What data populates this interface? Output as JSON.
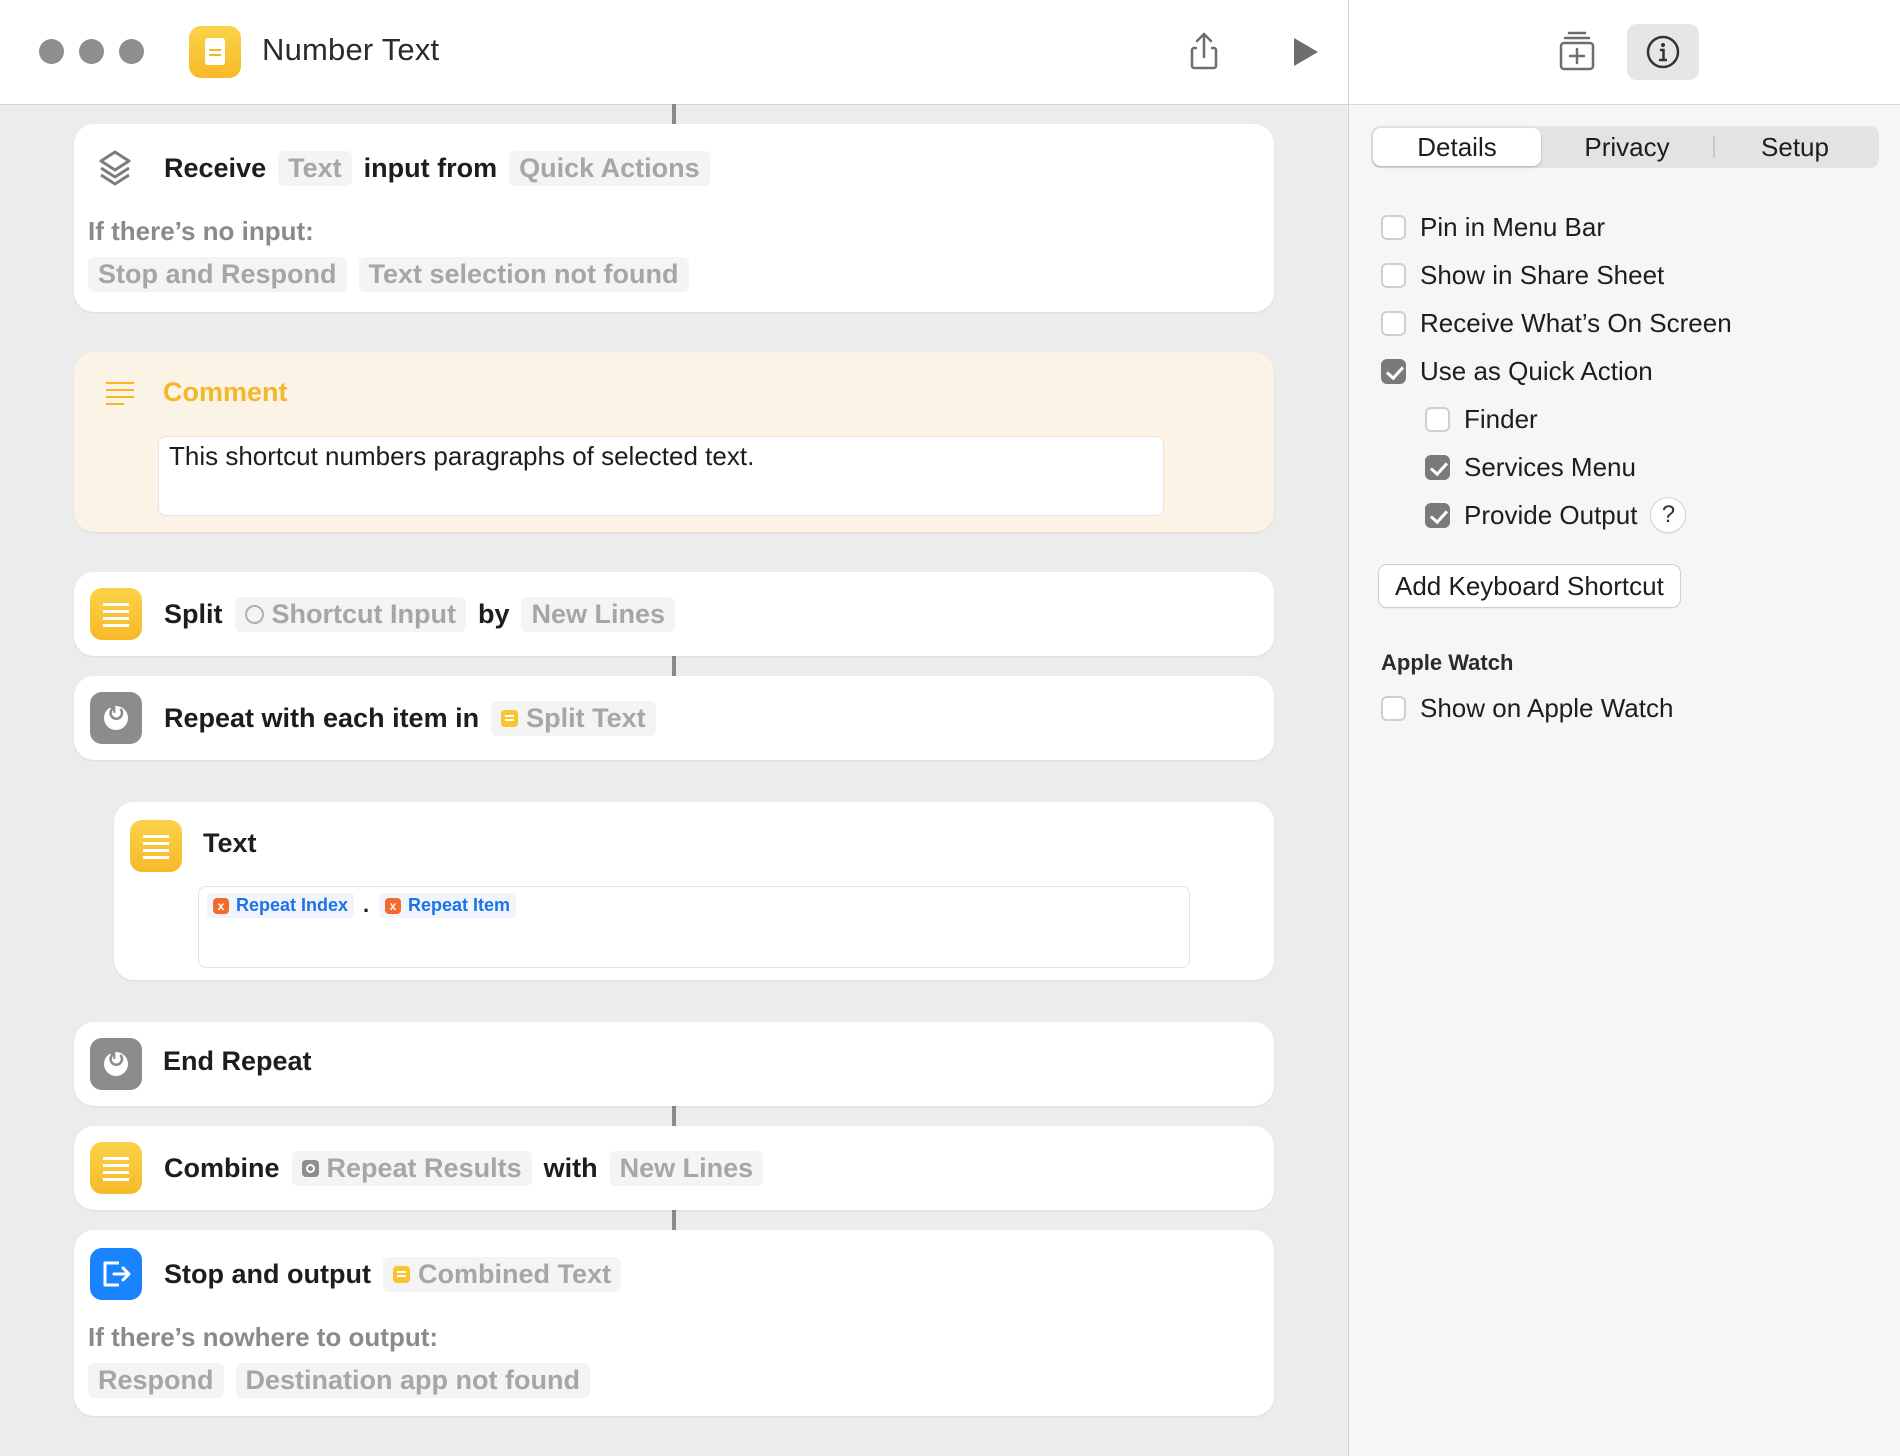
{
  "window": {
    "title": "Number Text",
    "buttons": [
      "share-icon",
      "play-icon",
      "action-library-icon",
      "info-icon"
    ]
  },
  "inspector": {
    "tabs": [
      {
        "label": "Details",
        "selected": true
      },
      {
        "label": "Privacy",
        "selected": false
      },
      {
        "label": "Setup",
        "selected": false
      }
    ],
    "options": [
      {
        "label": "Pin in Menu Bar",
        "checked": false
      },
      {
        "label": "Show in Share Sheet",
        "checked": false
      },
      {
        "label": "Receive What’s On Screen",
        "checked": false
      },
      {
        "label": "Use as Quick Action",
        "checked": true
      },
      {
        "label": "Finder",
        "checked": false
      },
      {
        "label": "Services Menu",
        "checked": true
      },
      {
        "label": "Provide Output",
        "checked": true
      }
    ],
    "help_label": "?",
    "keyboard_shortcut_button": "Add Keyboard Shortcut",
    "apple_watch": {
      "heading": "Apple Watch",
      "option": {
        "label": "Show on Apple Watch",
        "checked": false
      }
    }
  },
  "actions": {
    "receive": {
      "verb": "Receive",
      "type_token": "Text",
      "middle": "input from",
      "source_token": "Quick Actions",
      "fallback_label": "If there’s no input:",
      "fallback_action": "Stop and Respond",
      "fallback_message": "Text selection not found"
    },
    "comment": {
      "title": "Comment",
      "text": "This shortcut numbers paragraphs of selected text."
    },
    "split": {
      "verb": "Split",
      "input_token": "Shortcut Input",
      "by": "by",
      "separator_token": "New Lines"
    },
    "repeat": {
      "label": "Repeat with each item in",
      "list_token": "Split Text"
    },
    "text": {
      "title": "Text",
      "var1": "Repeat Index",
      "separator": ".",
      "var2": "Repeat Item"
    },
    "end_repeat": {
      "label": "End Repeat"
    },
    "combine": {
      "verb": "Combine",
      "input_token": "Repeat Results",
      "with": "with",
      "separator_token": "New Lines"
    },
    "stop_output": {
      "verb": "Stop and output",
      "output_token": "Combined Text",
      "fallback_label": "If there’s nowhere to output:",
      "fallback_action": "Respond",
      "fallback_message": "Destination app not found"
    }
  },
  "colors": {
    "accent_yellow": "#F7B928",
    "accent_blue": "#1A84FF",
    "variable_blue": "#1A74E8",
    "variable_orange": "#F26B2C",
    "comment_bg": "#FAF3E6"
  }
}
